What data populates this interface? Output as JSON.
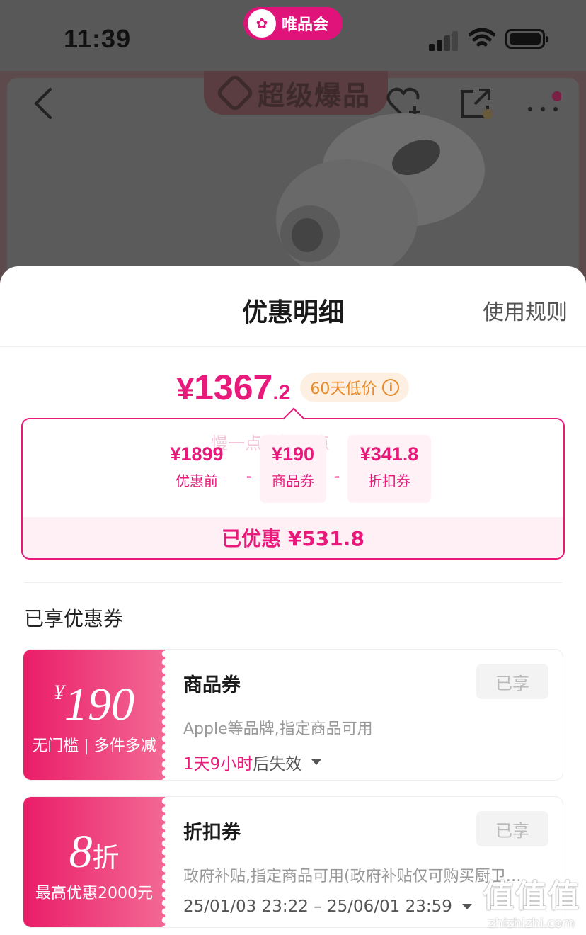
{
  "status_bar": {
    "time": "11:39",
    "app_name": "唯品会"
  },
  "header": {
    "banner": "超级爆品"
  },
  "sheet": {
    "title": "优惠明细",
    "rules_link": "使用规则",
    "price": {
      "currency": "¥",
      "integer": "1367",
      "decimal": ".2"
    },
    "low_price_badge": "60天低价",
    "watermark": "慢一点再慢一点",
    "breakdown": {
      "items": [
        {
          "amount": "¥1899",
          "label": "优惠前"
        },
        {
          "amount": "¥190",
          "label": "商品券"
        },
        {
          "amount": "¥341.8",
          "label": "折扣券"
        }
      ],
      "operator": "-",
      "total": "已优惠 ¥531.8"
    },
    "section_title": "已享优惠券",
    "coupons": [
      {
        "symbol": "¥",
        "value": "190",
        "unit": "",
        "condition": "无门槛 | 多件多减",
        "name": "商品券",
        "desc": "Apple等品牌,指定商品可用",
        "expiry_highlight": "1天9小时",
        "expiry_rest": " 后失效",
        "status": "已享"
      },
      {
        "symbol": "",
        "value": "8",
        "unit": "折",
        "condition": "最高优惠2000元",
        "name": "折扣券",
        "desc": "政府补贴,指定商品可用(政府补贴仅可购买厨卫…",
        "expiry_highlight": "",
        "expiry_rest": "25/01/03 23:22 – 25/06/01 23:59",
        "status": "已享"
      }
    ]
  },
  "site_watermark": {
    "glyphs": "值值值",
    "url": "zhizhizhi.com"
  },
  "colors": {
    "accent": "#e8197a",
    "badge_text": "#e68a2a",
    "badge_bg": "#fdf0e2"
  }
}
